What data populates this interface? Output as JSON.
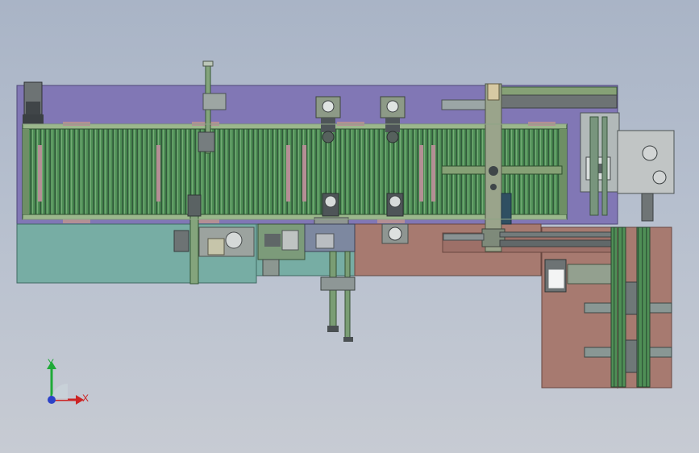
{
  "viewport": {
    "background_top": "#a9b4c6",
    "background_bottom": "#c7cbd3"
  },
  "model": {
    "colors": {
      "base_plate_blue": "#8177b5",
      "base_plate_teal": "#77ada4",
      "base_plate_brown": "#a77a70",
      "conveyor_green": "#4f8f56",
      "conveyor_dark": "#2a4d34",
      "frame_olive": "#86a176",
      "frame_gray": "#6d7374",
      "motor_dark": "#404548"
    }
  },
  "triad": {
    "x_label": "X",
    "y_label": "Y",
    "x_color": "#cc2424",
    "y_color": "#1faa38",
    "z_color": "#2c42c8"
  }
}
